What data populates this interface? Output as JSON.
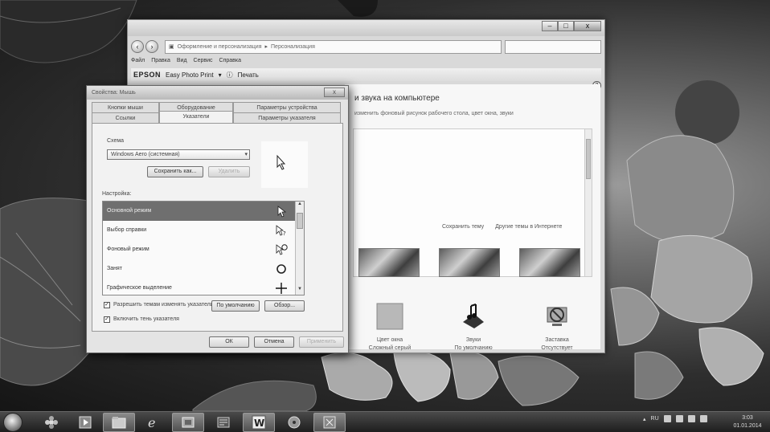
{
  "control_panel": {
    "heading": "и звука на компьютере",
    "description": "изменить фоновый рисунок рабочего стола, цвет окна, звуки",
    "address_segments": [
      "Оформление и персонализация",
      "Персонализация"
    ],
    "menu": [
      "Файл",
      "Правка",
      "Вид",
      "Сервис",
      "Справка"
    ],
    "toolbar": {
      "brand": "EPSON",
      "app": "Easy Photo Print",
      "help": "Печать"
    },
    "theme_links": [
      "Сохранить тему",
      "Другие темы в Интернете"
    ],
    "bottom_items": [
      {
        "label": "Цвет окна",
        "sub": "Сложный серый"
      },
      {
        "label": "Звуки",
        "sub": "По умолчанию"
      },
      {
        "label": "Заставка",
        "sub": "Отсутствует"
      }
    ],
    "window_buttons": {
      "minimize": "–",
      "maximize": "□",
      "close": "x"
    }
  },
  "dialog": {
    "title": "Свойства: Мышь",
    "close": "x",
    "tabs_back": [
      "Кнопки мыши",
      "Оборудование",
      "Параметры устройства"
    ],
    "tabs_front": [
      "Ссылки",
      "Указатели",
      "Параметры указателя"
    ],
    "scheme_label": "Схема",
    "scheme_value": "Windows Aero (системная)",
    "save_as": "Сохранить как...",
    "delete": "Удалить",
    "setup_label": "Настройка:",
    "pointers": [
      "Основной режим",
      "Выбор справки",
      "Фоновый режим",
      "Занят",
      "Графическое выделение"
    ],
    "allow_themes": "Разрешить темам изменять указатели мыши",
    "enable_shadow": "Включить тень указателя",
    "default_btn": "По умолчанию",
    "browse_btn": "Обзор...",
    "ok": "ОК",
    "cancel": "Отмена",
    "apply": "Применить"
  },
  "taskbar": {
    "lang": "RU",
    "time": "3:03",
    "date": "01.01.2014"
  }
}
